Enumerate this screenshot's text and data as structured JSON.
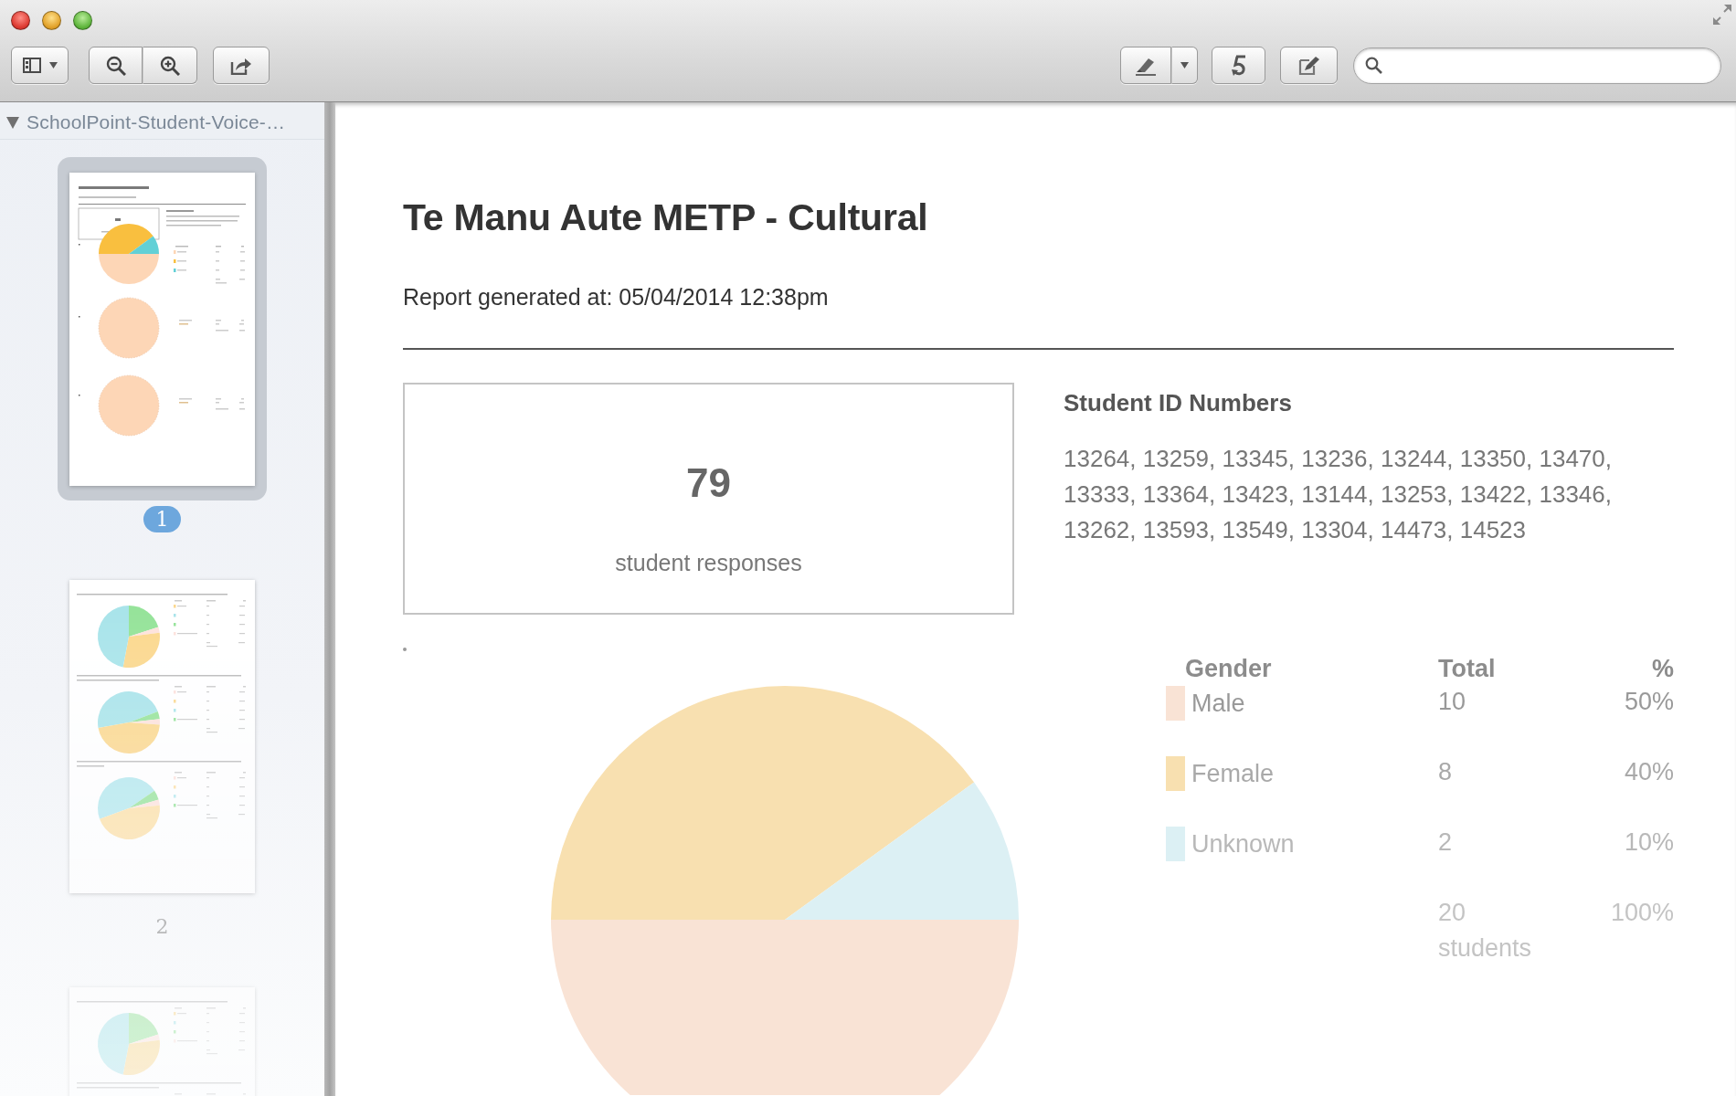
{
  "sidebar": {
    "document": {
      "title": "SchoolPoint-Student-Voice-…",
      "expanded": true
    },
    "pages": [
      {
        "label": "1",
        "kind": "summary",
        "selected": true
      },
      {
        "label": "2",
        "kind": "questions",
        "selected": false
      },
      {
        "kind": "questions",
        "selected": false
      }
    ]
  },
  "report": {
    "title": "Te Manu Aute METP - Cultural",
    "generated": "Report generated at: 05/04/2014 12:38pm",
    "responses": {
      "count": "79",
      "label": "student responses"
    },
    "student_ids": {
      "heading": "Student ID Numbers",
      "numbers": "13264, 13259, 13345, 13236, 13244, 13350, 13470, 13333, 13364, 13423, 13144, 13253, 13422, 13346, 13262, 13593, 13549, 13304, 14473, 14523"
    },
    "gender": {
      "columns": [
        "Gender",
        "Total",
        "%"
      ],
      "rows": [
        {
          "total": "10",
          "percent": "50%",
          "color": "#f9e3d5"
        },
        {
          "total": "8",
          "percent": "40%",
          "color": "#f8e0b0"
        },
        {
          "total": "2",
          "percent": "10%",
          "color": "#dcf0f4"
        }
      ],
      "footer": {
        "total": "20 students",
        "percent": "100%"
      },
      "chart_data": {
        "type": "pie",
        "categories": [
          "Male",
          "Female",
          "Unknown"
        ],
        "values": [
          50,
          40,
          10
        ]
      }
    }
  }
}
